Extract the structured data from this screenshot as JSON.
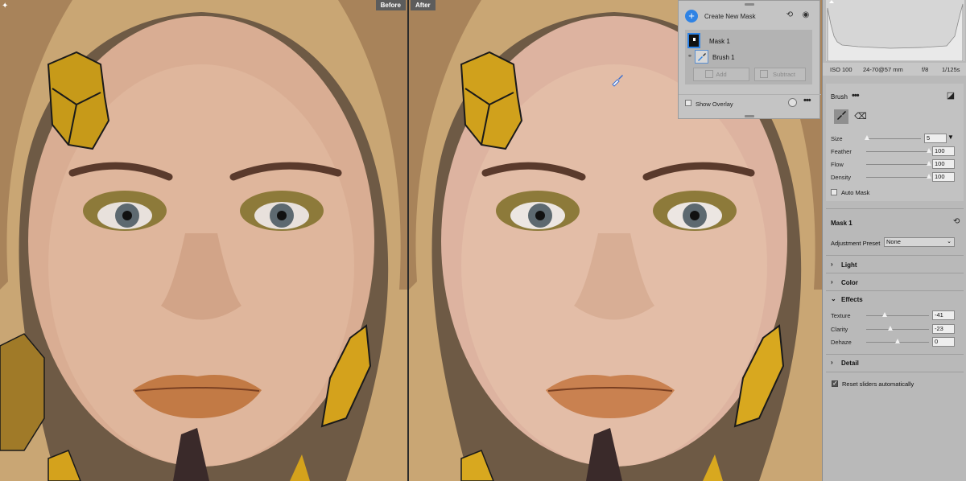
{
  "views": {
    "before_label": "Before",
    "after_label": "After"
  },
  "mask_panel": {
    "create_label": "Create New Mask",
    "mask_name": "Mask 1",
    "brush_name": "Brush 1",
    "add_label": "Add",
    "subtract_label": "Subtract",
    "show_overlay_label": "Show Overlay",
    "icons": [
      "plus-icon",
      "undo-icon",
      "eye-icon",
      "link-icon",
      "brush-icon",
      "more-icon"
    ]
  },
  "exif": {
    "iso": "ISO 100",
    "lens": "24-70@57 mm",
    "aperture": "f/8",
    "shutter": "1/125s"
  },
  "brush": {
    "title": "Brush",
    "auto_mask_label": "Auto Mask",
    "sliders": [
      {
        "label": "Size",
        "value": "5",
        "level": 0.02
      },
      {
        "label": "Feather",
        "value": "100",
        "level": 1.0
      },
      {
        "label": "Flow",
        "value": "100",
        "level": 1.0
      },
      {
        "label": "Density",
        "value": "100",
        "level": 1.0
      }
    ]
  },
  "mask_settings": {
    "title": "Mask 1",
    "preset_label": "Adjustment Preset",
    "preset_value": "None"
  },
  "sections": {
    "light": "Light",
    "color": "Color",
    "effects": "Effects",
    "detail": "Detail"
  },
  "effects": [
    {
      "label": "Texture",
      "value": "-41",
      "level": -0.41
    },
    {
      "label": "Clarity",
      "value": "-23",
      "level": -0.23
    },
    {
      "label": "Dehaze",
      "value": "0",
      "level": 0
    }
  ],
  "reset_label": "Reset sliders automatically",
  "colors": {
    "accent": "#2f83e4",
    "panel": "#b9b9b9"
  }
}
